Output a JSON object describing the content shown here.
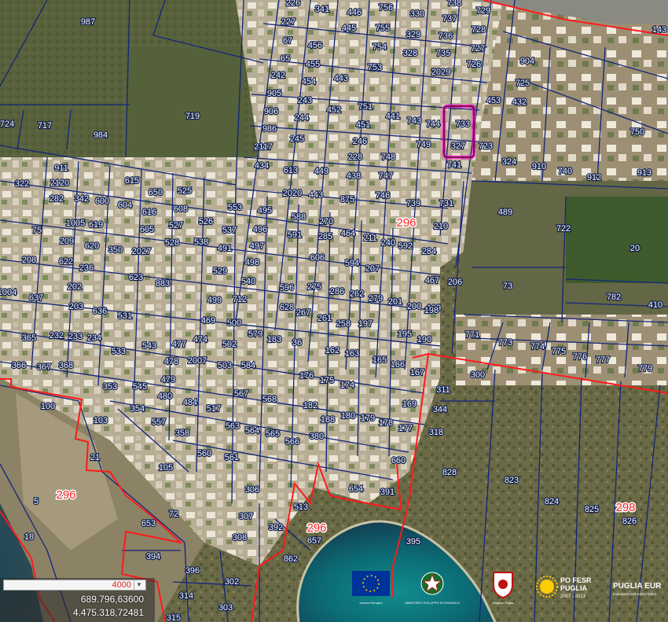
{
  "map": {
    "parcels": [
      "987",
      "226",
      "341",
      "446",
      "756",
      "330",
      "737",
      "738",
      "729",
      "143",
      "227",
      "445",
      "755",
      "329",
      "736",
      "728",
      "67",
      "456",
      "754",
      "328",
      "735",
      "727",
      "904",
      "65",
      "455",
      "753",
      "726",
      "242",
      "454",
      "443",
      "2029",
      "725",
      "905",
      "243",
      "453",
      "751",
      "432",
      "906",
      "244",
      "452",
      "441",
      "743",
      "744",
      "733",
      "724",
      "717",
      "719",
      "984",
      "986",
      "245",
      "451",
      "750",
      "2117",
      "246",
      "749",
      "327",
      "723",
      "434",
      "228",
      "748",
      "741",
      "324",
      "910",
      "911",
      "613",
      "449",
      "438",
      "747",
      "740",
      "912",
      "913",
      "2120",
      "615",
      "650",
      "525",
      "2020",
      "443",
      "875",
      "746",
      "739",
      "731",
      "322",
      "342",
      "600",
      "604",
      "608",
      "553",
      "495",
      "588",
      "270",
      "282",
      "616",
      "526",
      "489",
      "1005",
      "619",
      "605",
      "527",
      "537",
      "496",
      "591",
      "285",
      "464",
      "211",
      "240",
      "210",
      "722",
      "20",
      "75",
      "350",
      "2027",
      "528",
      "538",
      "491",
      "497",
      "592",
      "209",
      "620",
      "606",
      "284",
      "208",
      "622",
      "236",
      "623",
      "529",
      "498",
      "594",
      "207",
      "206",
      "73",
      "1004",
      "883",
      "540",
      "596",
      "275",
      "286",
      "262",
      "202",
      "637",
      "712",
      "499",
      "467",
      "203",
      "636",
      "628",
      "267",
      "279",
      "201",
      "200",
      "199",
      "782",
      "410",
      "198",
      "531",
      "469",
      "500",
      "261",
      "258",
      "197",
      "365",
      "232",
      "233",
      "234",
      "579",
      "183",
      "36",
      "195",
      "190",
      "771",
      "773",
      "774",
      "775",
      "776",
      "777",
      "779",
      "533",
      "543",
      "477",
      "474",
      "502",
      "162",
      "163",
      "366",
      "367",
      "368",
      "478",
      "2007",
      "503",
      "584",
      "165",
      "166",
      "167",
      "176",
      "175",
      "174",
      "300",
      "479",
      "545",
      "480",
      "484",
      "517",
      "567",
      "568",
      "182",
      "311",
      "169",
      "353",
      "100",
      "103",
      "354",
      "557",
      "563",
      "564",
      "565",
      "188",
      "180",
      "179",
      "178",
      "177",
      "344",
      "358",
      "560",
      "380",
      "566",
      "318",
      "561",
      "21",
      "105",
      "660",
      "828",
      "306",
      "654",
      "391",
      "296",
      "513",
      "5",
      "653",
      "72",
      "823",
      "824",
      "825",
      "298",
      "826",
      "307",
      "392",
      "18",
      "308",
      "657",
      "395",
      "394",
      "862",
      "396",
      "302",
      "314",
      "303",
      "315",
      "296",
      "296"
    ],
    "sheet_labels": [
      "296",
      "296",
      "296",
      "298"
    ],
    "logos": {
      "eu_caption": "Unione Europea",
      "ministry_caption": "MINISTERO SVILUPPO ECONOMICO",
      "region_caption": "Regione Puglia",
      "po_line1": "PO FESR",
      "po_line2": "PUGLIA",
      "po_years": "2007 - 2013",
      "puglia_brand": "PUGLIA EUR",
      "puglia_sub": "Investiamo nel vostro futuro"
    }
  },
  "scale": {
    "value": "4000"
  },
  "coords": {
    "x": "689.796,63600",
    "y": "4.475.318,72481"
  }
}
